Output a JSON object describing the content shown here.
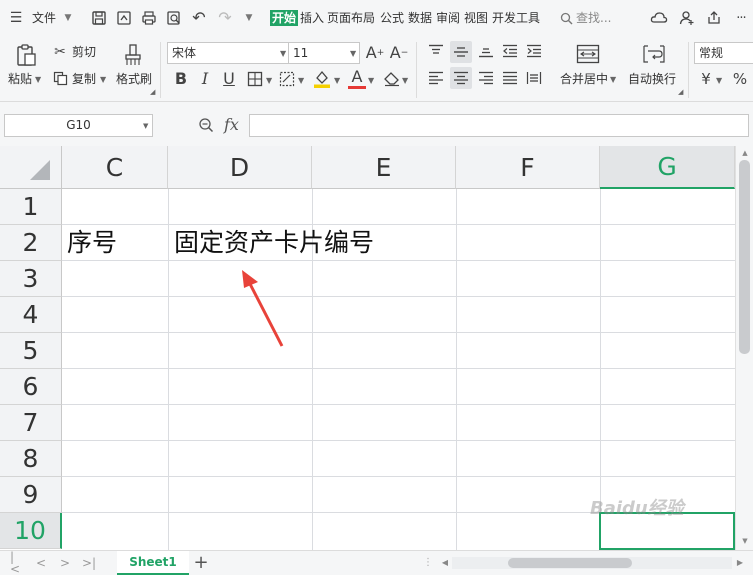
{
  "menu": {
    "file_label": "文件",
    "tabs": [
      {
        "label": "开始",
        "active": true
      },
      {
        "label": "插入"
      },
      {
        "label": "页面布局"
      },
      {
        "label": "公式"
      },
      {
        "label": "数据"
      },
      {
        "label": "审阅"
      },
      {
        "label": "视图"
      },
      {
        "label": "开发工具"
      }
    ],
    "search_label": "查找..."
  },
  "ribbon": {
    "paste_label": "粘贴",
    "cut_label": "剪切",
    "copy_label": "复制",
    "format_painter_label": "格式刷",
    "font_name": "宋体",
    "font_size": "11",
    "bold": "B",
    "italic": "I",
    "underline": "U",
    "font_color_letter": "A",
    "font_grow": "A⁺",
    "font_shrink": "A⁻",
    "merge_label": "合并居中",
    "wrap_label": "自动换行",
    "number_format": "常规",
    "currency_symbol": "¥",
    "percent_symbol": "%"
  },
  "formula_bar": {
    "name_box": "G10",
    "fx_label": "fx",
    "formula_value": ""
  },
  "grid": {
    "columns": [
      {
        "label": "C"
      },
      {
        "label": "D"
      },
      {
        "label": "E"
      },
      {
        "label": "F"
      },
      {
        "label": "G",
        "selected": true
      }
    ],
    "rows": [
      {
        "label": "1"
      },
      {
        "label": "2"
      },
      {
        "label": "3"
      },
      {
        "label": "4"
      },
      {
        "label": "5"
      },
      {
        "label": "6"
      },
      {
        "label": "7"
      },
      {
        "label": "8"
      },
      {
        "label": "9"
      },
      {
        "label": "10",
        "selected": true
      }
    ],
    "cells": {
      "C2": "序号",
      "D2": "固定资产卡片编号"
    },
    "selected_cell": "G10"
  },
  "sheets": {
    "tabs": [
      {
        "label": "Sheet1",
        "active": true
      }
    ],
    "add_label": "+"
  },
  "colors": {
    "accent": "#21a366",
    "arrow": "#e8433a"
  },
  "watermark": "Baidu经验"
}
